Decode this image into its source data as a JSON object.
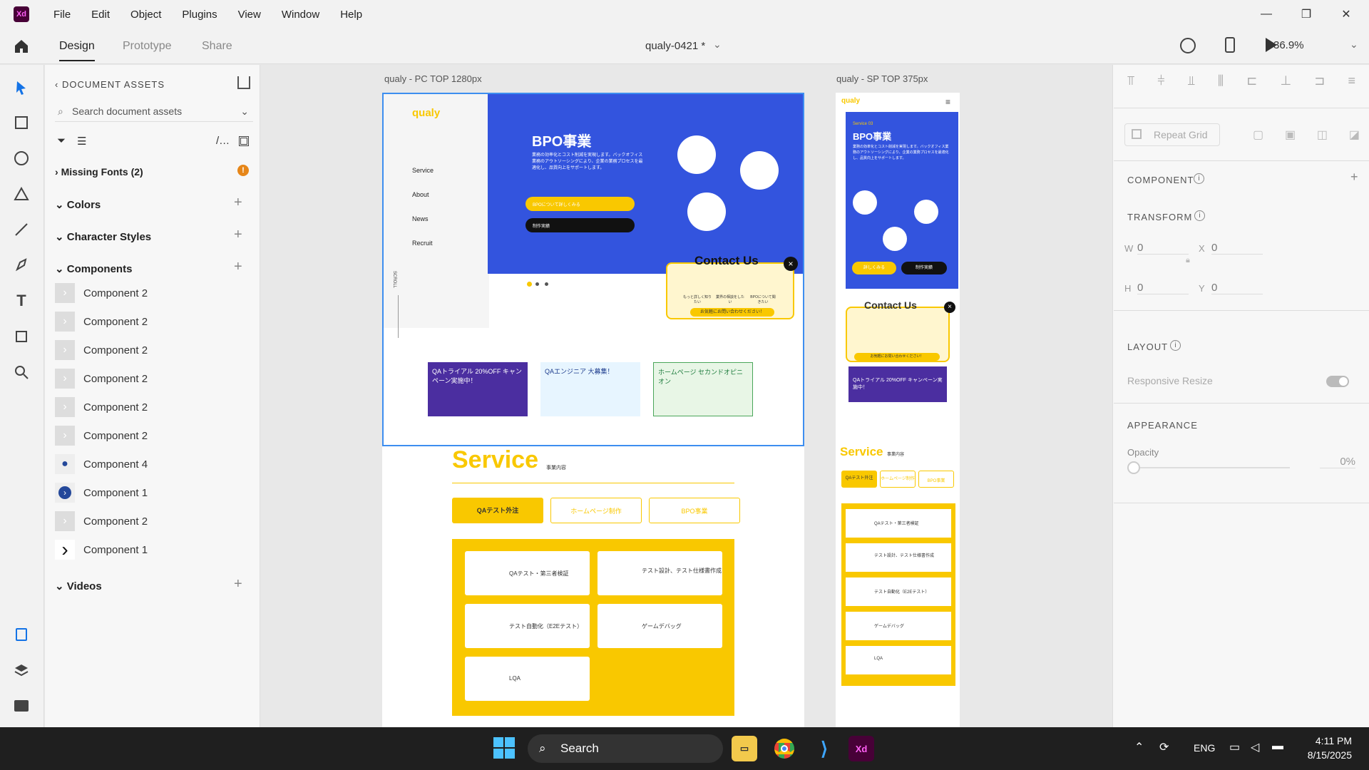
{
  "menubar": {
    "logo": "Xd",
    "items": [
      "File",
      "Edit",
      "Object",
      "Plugins",
      "View",
      "Window",
      "Help"
    ]
  },
  "toolbar": {
    "tabs": [
      "Design",
      "Prototype",
      "Share"
    ],
    "doc_title": "qualy-0421 *",
    "zoom": "36.9%"
  },
  "assets": {
    "header": "DOCUMENT ASSETS",
    "search_placeholder": "Search document assets",
    "missing_fonts": "Missing Fonts (2)",
    "sections": [
      "Colors",
      "Character Styles",
      "Components",
      "Videos"
    ],
    "components": [
      "Component 2",
      "Component 2",
      "Component 2",
      "Component 2",
      "Component 2",
      "Component 2",
      "Component 4",
      "Component 1",
      "Component 2",
      "Component 1"
    ]
  },
  "canvas": {
    "pc_label": "qualy - PC TOP 1280px",
    "sp_label": "qualy - SP TOP 375px",
    "brand": "qualy",
    "hero_title": "BPO事業",
    "hero_text": "業務の効率化とコスト削減を実現します。バックオフィス業務のアウトソーシングにより、企業の業務プロセスを最適化し、品質向上をサポートします。",
    "hero_btn1": "BPOについて詳しくみる",
    "hero_btn2": "制作実績",
    "nav": [
      "Service",
      "About",
      "News",
      "Recruit"
    ],
    "scroll": "SCROLL",
    "contact_title": "Contact Us",
    "contact_items": [
      "もっと詳しく知りたい",
      "業界の相談をしたい",
      "BPOについて聞きたい"
    ],
    "contact_cta": "お気軽にお問い合わせください！",
    "banners": [
      "QAトライアル 20%OFF キャンペーン実施中！",
      "QAエンジニア 大募集！",
      "ホームページ セカンドオピニオン"
    ],
    "service_title": "Service",
    "service_sub": "事業内容",
    "service_tabs": [
      "QAテスト外注",
      "ホームページ制作",
      "BPO事業"
    ],
    "service_items": [
      "QAテスト・第三者検証",
      "テスト設計、テスト仕様書作成",
      "テスト自動化（E2Eテスト）",
      "ゲームデバッグ",
      "LQA"
    ],
    "sp_hero_label": "Service 03",
    "sp_btn1": "詳しくみる",
    "sp_btn2": "制作実績"
  },
  "rightpanel": {
    "repeat_grid": "Repeat Grid",
    "component": "COMPONENT",
    "transform": "TRANSFORM",
    "w_label": "W",
    "w": "0",
    "x_label": "X",
    "x": "0",
    "h_label": "H",
    "h": "0",
    "y_label": "Y",
    "y": "0",
    "layout": "LAYOUT",
    "responsive": "Responsive Resize",
    "appearance": "APPEARANCE",
    "opacity_label": "Opacity",
    "opacity": "0%"
  },
  "taskbar": {
    "search": "Search",
    "lang": "ENG",
    "time": "4:11 PM",
    "date": "8/15/2025"
  }
}
